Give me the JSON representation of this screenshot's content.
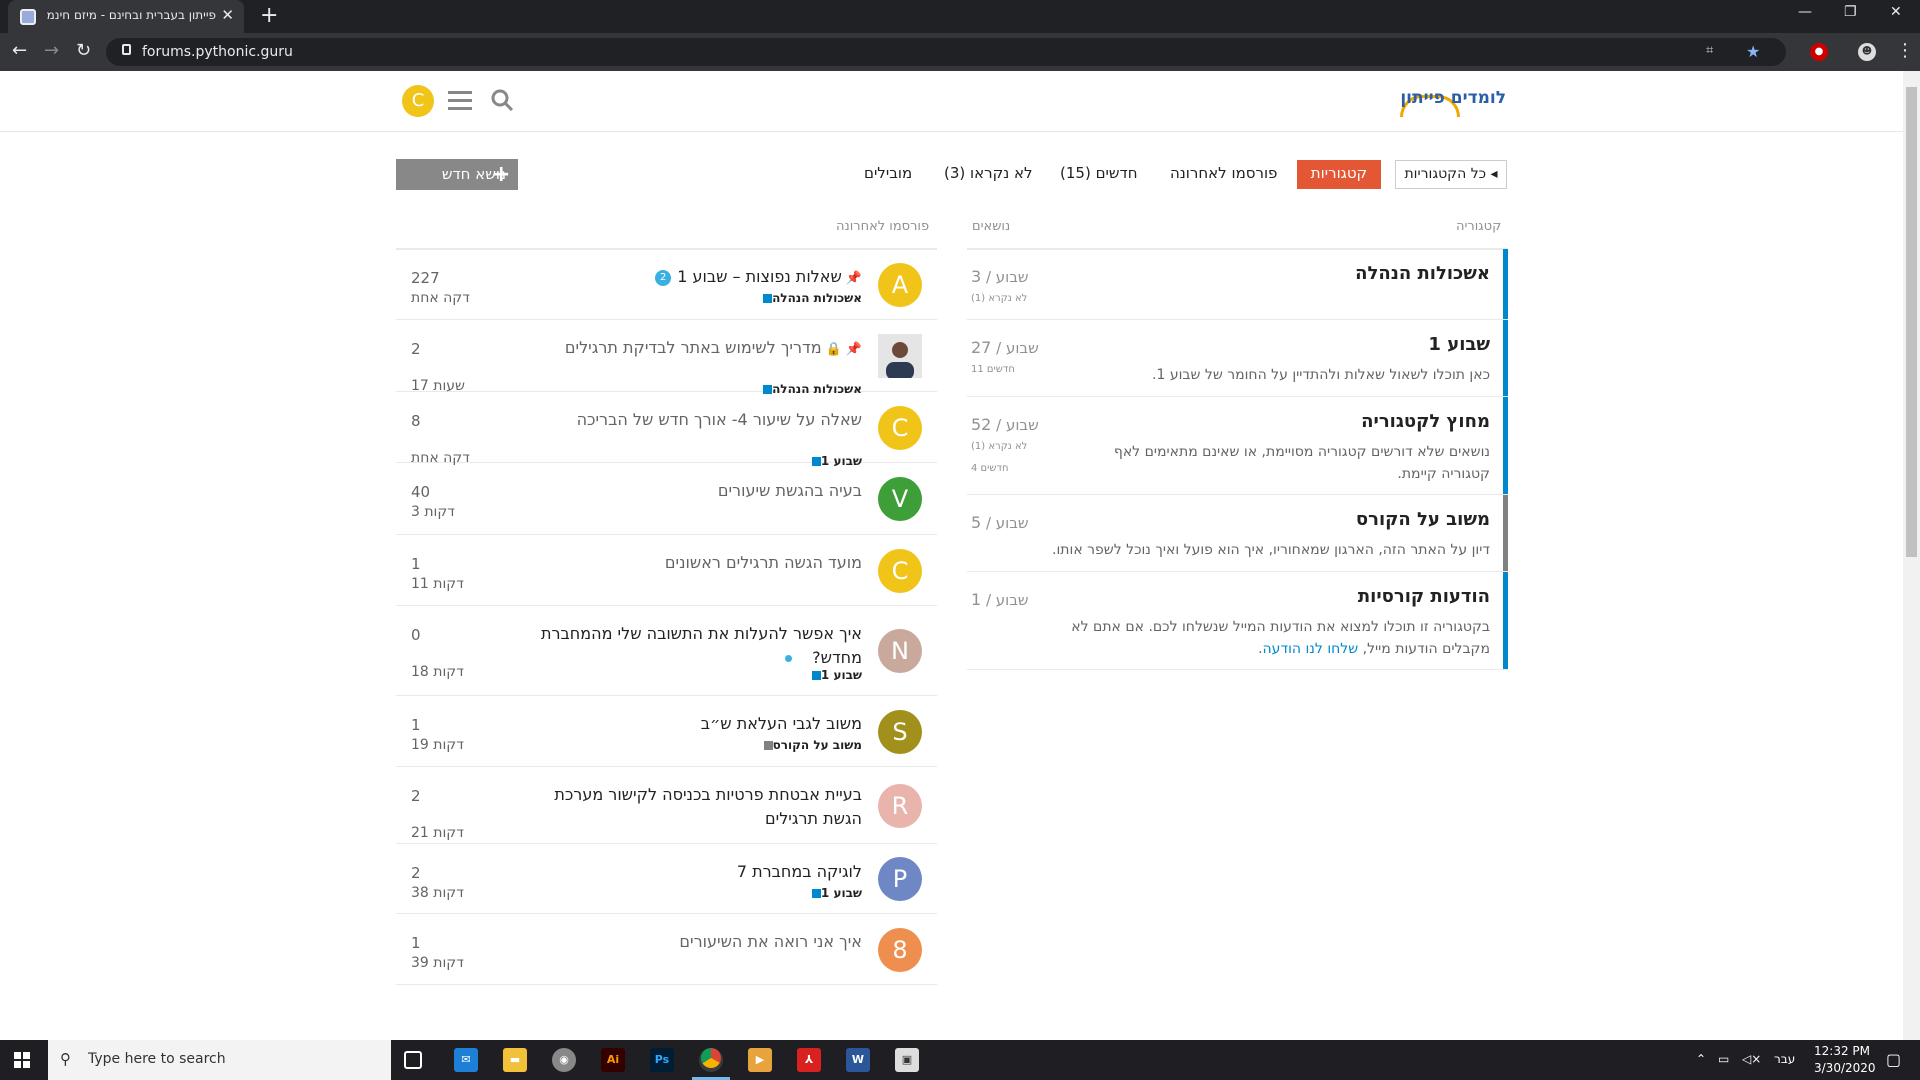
{
  "browser": {
    "tab_title": "פייתון בעברית ובחינם - מיזם חינמי",
    "url": "forums.pythonic.guru"
  },
  "site": {
    "logo_text": "לומדים פייתון",
    "user_avatar_letter": "C"
  },
  "nav": {
    "all_categories": "כל הקטגוריות",
    "pills": [
      "קטגוריות",
      "פורסמו לאחרונה",
      "חדשים (15)",
      "לא נקראו (3)",
      "מובילים"
    ],
    "new_topic": "נושא חדש"
  },
  "categories_table": {
    "header_category": "קטגוריה",
    "header_topics": "נושאים",
    "rows": [
      {
        "name": "אשכולות הנהלה",
        "description": "",
        "count": "3",
        "period": "שבוע",
        "sub1": "לא נקרא (1)",
        "sub2": "",
        "color": "#0088cc"
      },
      {
        "name": "שבוע 1",
        "description": "כאן תוכלו לשאול שאלות ולהתדיין על החומר של שבוע 1.",
        "count": "27",
        "period": "שבוע",
        "sub1": "11 חדשים",
        "sub2": "",
        "color": "#0088cc"
      },
      {
        "name": "מחוץ לקטגוריה",
        "description": "נושאים שלא דורשים קטגוריה מסויימת, או שאינם מתאימים לאף קטגוריה קיימת.",
        "count": "52",
        "period": "שבוע",
        "sub1": "לא נקרא (1)",
        "sub2": "4 חדשים",
        "color": "#0088cc"
      },
      {
        "name": "משוב על הקורס",
        "description": "דיון על האתר הזה, הארגון שמאחוריו, איך הוא פועל ואיך נוכל לשפר אותו.",
        "count": "5",
        "period": "שבוע",
        "sub1": "",
        "sub2": "",
        "color": "#808281"
      },
      {
        "name": "הודעות קורסיות",
        "description": "בקטגוריה זו תוכלו למצוא את הודעות המייל שנשלחו לכם. אם אתם לא מקבלים הודעות מייל,",
        "link": "שלחו לנו הודעה",
        "count": "1",
        "period": "שבוע",
        "sub1": "",
        "sub2": "",
        "color": "#0088cc"
      }
    ]
  },
  "latest": {
    "header": "פורסמו לאחרונה",
    "rows": [
      {
        "avatar": "A",
        "avatar_color": "#f0c419",
        "title": "שאלות נפוצות – שבוע 1",
        "pinned": true,
        "locked": false,
        "badge": "2",
        "category": "אשכולות הנהלה",
        "cat_color": "#0088cc",
        "posts": "227",
        "age": "דקה אחת"
      },
      {
        "avatar": "",
        "avatar_color": "#555",
        "photo": true,
        "title": "מדריך לשימוש באתר לבדיקת תרגילים",
        "pinned": true,
        "locked": true,
        "badge": "",
        "category": "אשכולות הנהלה",
        "cat_color": "#0088cc",
        "posts": "2",
        "age": "17 שעות",
        "read": true
      },
      {
        "avatar": "C",
        "avatar_color": "#f0c419",
        "title": "שאלה על שיעור 4- אורך חדש של הבריכה",
        "pinned": false,
        "locked": false,
        "badge": "",
        "category": "שבוע 1",
        "cat_color": "#0088cc",
        "posts": "8",
        "age": "דקה אחת",
        "read": true
      },
      {
        "avatar": "V",
        "avatar_color": "#3e9e37",
        "title": "בעיה בהגשת שיעורים",
        "category": "",
        "posts": "40",
        "age": "3 דקות",
        "read": true
      },
      {
        "avatar": "C",
        "avatar_color": "#f0c419",
        "title": "מועד הגשה תרגילים ראשונים",
        "category": "",
        "posts": "1",
        "age": "11 דקות",
        "read": true
      },
      {
        "avatar": "N",
        "avatar_color": "#c9a99b",
        "title": "איך אפשר להעלות את התשובה שלי מהמחברת מחדש?",
        "dot": true,
        "category": "שבוע 1",
        "cat_color": "#0088cc",
        "posts": "0",
        "age": "18 דקות"
      },
      {
        "avatar": "S",
        "avatar_color": "#a2901c",
        "title": "משוב לגבי העלאת ש״ב",
        "category": "משוב על הקורס",
        "cat_color": "#808281",
        "posts": "1",
        "age": "19 דקות"
      },
      {
        "avatar": "R",
        "avatar_color": "#e8b4ac",
        "title": "בעיית אבטחת פרטיות בכניסה לקישור מערכת הגשת תרגילים",
        "category": "",
        "posts": "2",
        "age": "21 דקות"
      },
      {
        "avatar": "P",
        "avatar_color": "#6f87c4",
        "title": "לוגיקה במחברת 7",
        "category": "שבוע 1",
        "cat_color": "#0088cc",
        "posts": "2",
        "age": "38 דקות"
      },
      {
        "avatar": "8",
        "avatar_color": "#ef8f4f",
        "title": "איך אני רואה את השיעורים",
        "category": "",
        "posts": "1",
        "age": "39 דקות",
        "read": true
      }
    ]
  },
  "taskbar": {
    "search_placeholder": "Type here to search",
    "lang": "עבר",
    "time": "12:32 PM",
    "date": "3/30/2020"
  }
}
